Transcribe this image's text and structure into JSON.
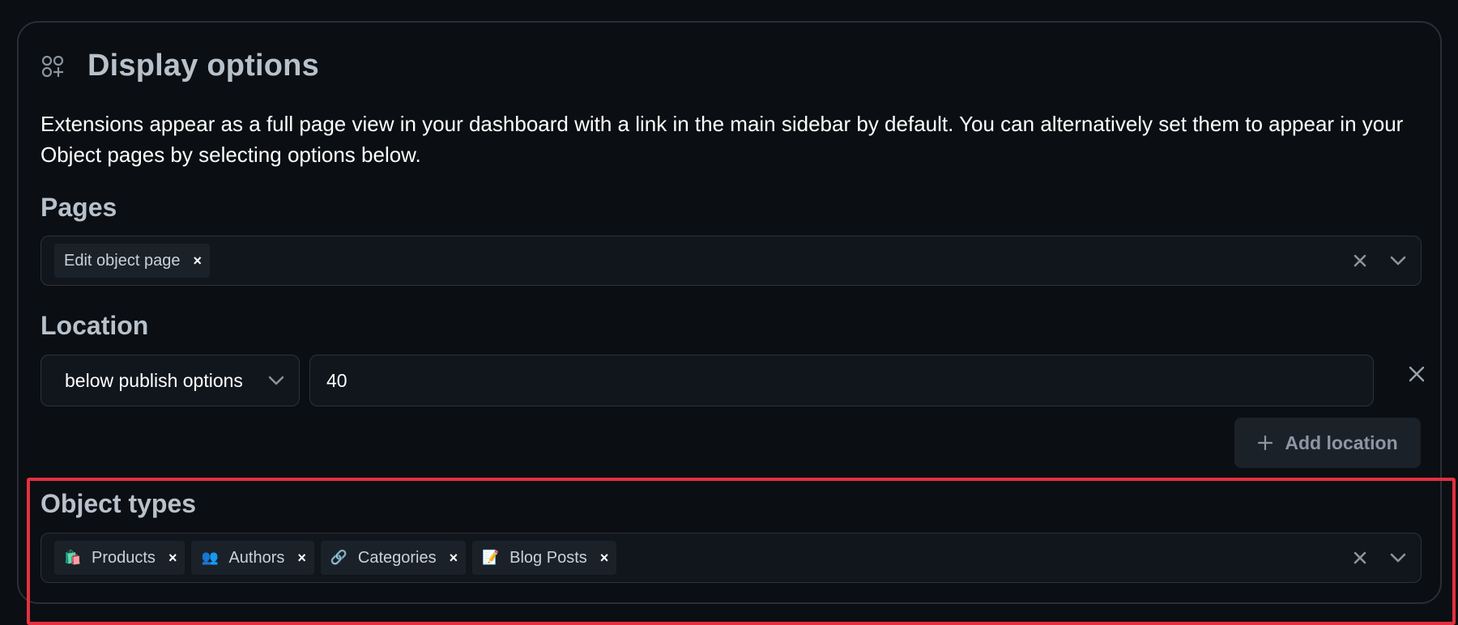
{
  "header": {
    "title": "Display options",
    "icon": "shapes-add-icon"
  },
  "description": "Extensions appear as a full page view in your dashboard with a link in the main sidebar by default. You can alternatively set them to appear in your Object pages by selecting options below.",
  "pages": {
    "label": "Pages",
    "chips": [
      {
        "label": "Edit object page"
      }
    ]
  },
  "location": {
    "label": "Location",
    "select_value": "below publish options",
    "input_value": "40",
    "add_label": "Add location"
  },
  "object_types": {
    "label": "Object types",
    "chips": [
      {
        "emoji": "🛍️",
        "label": "Products"
      },
      {
        "emoji": "👥",
        "label": "Authors"
      },
      {
        "emoji": "🔗",
        "label": "Categories"
      },
      {
        "emoji": "📝",
        "label": "Blog Posts"
      }
    ]
  },
  "colors": {
    "background": "#0b0e12",
    "highlight": "#e5303f",
    "label": "#b7c1cc"
  }
}
